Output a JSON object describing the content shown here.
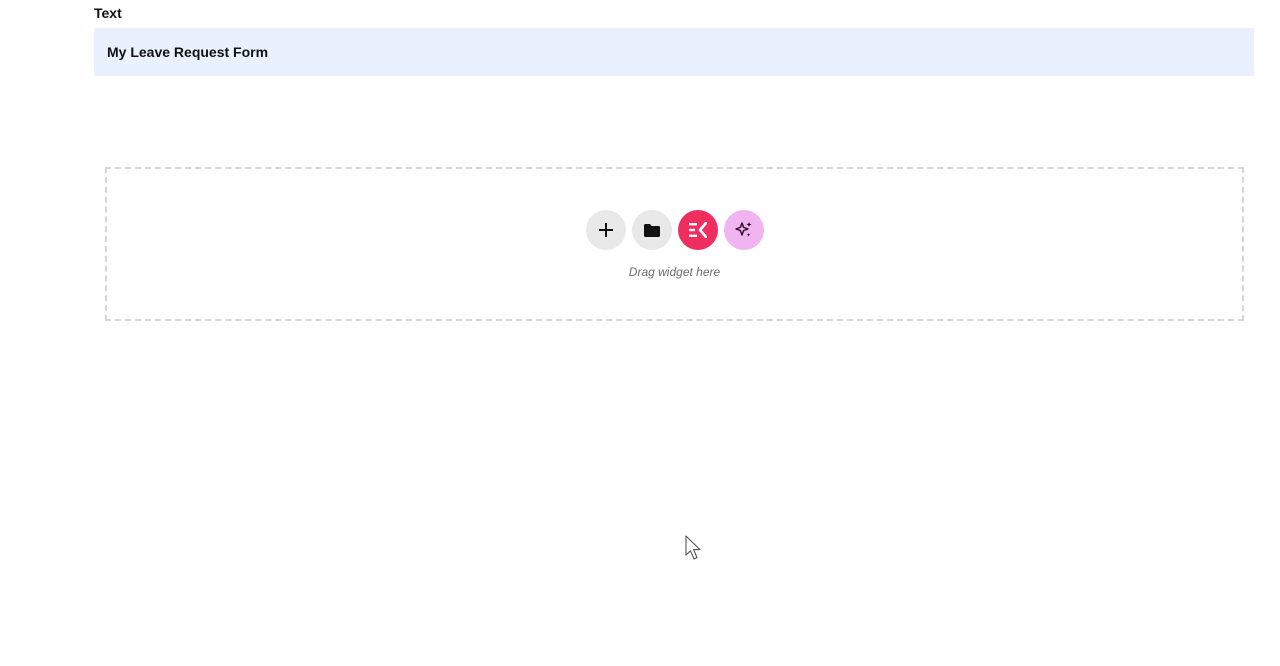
{
  "section": {
    "label": "Text"
  },
  "text_widget": {
    "content": "My Leave Request Form",
    "background": "#eaf1fe"
  },
  "dropzone": {
    "hint": "Drag widget here",
    "buttons": [
      {
        "icon": "plus-icon",
        "background": "#e8e8e8"
      },
      {
        "icon": "folder-icon",
        "background": "#e8e8e8"
      },
      {
        "icon": "elementskit-logo-icon",
        "background": "#ef2d5e"
      },
      {
        "icon": "ai-sparkle-icon",
        "background": "#f0b4f0"
      }
    ]
  },
  "cursor": {
    "icon": "mouse-pointer-icon"
  }
}
